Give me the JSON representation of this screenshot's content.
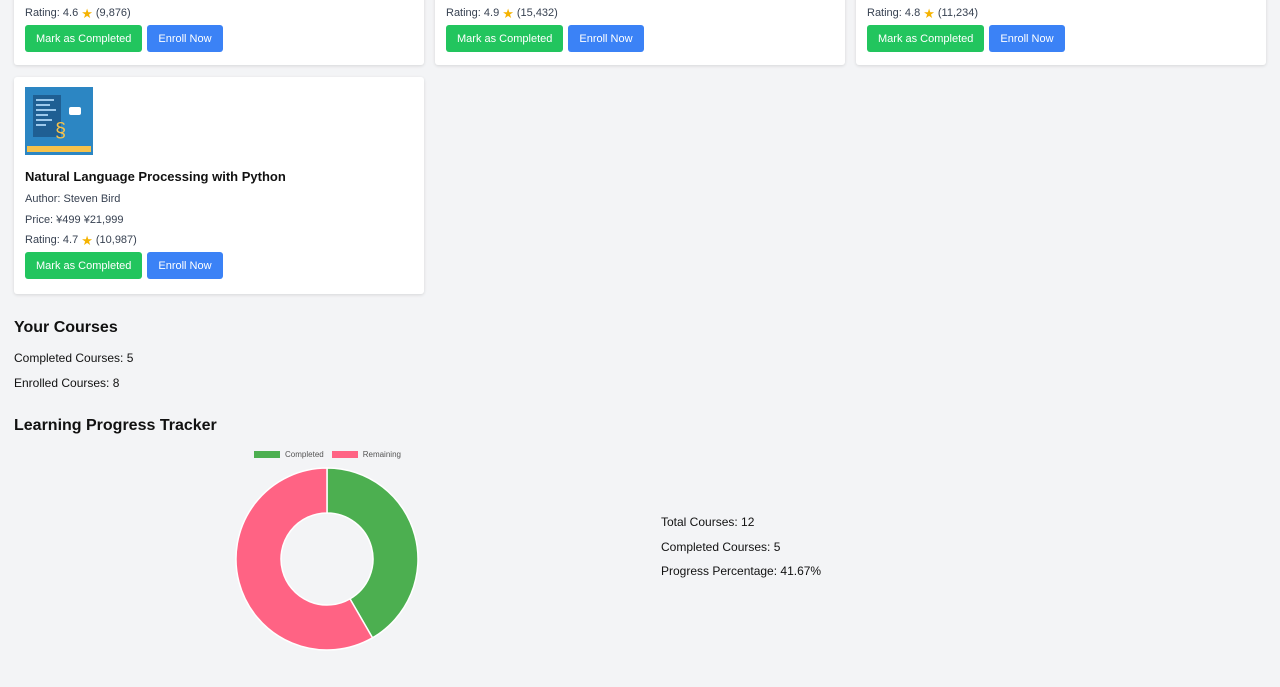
{
  "top_cards": [
    {
      "rating_prefix": "Rating: 4.6",
      "rating_count": "(9,876)",
      "complete_label": "Mark as Completed",
      "enroll_label": "Enroll Now"
    },
    {
      "rating_prefix": "Rating: 4.9",
      "rating_count": "(15,432)",
      "complete_label": "Mark as Completed",
      "enroll_label": "Enroll Now"
    },
    {
      "rating_prefix": "Rating: 4.8",
      "rating_count": "(11,234)",
      "complete_label": "Mark as Completed",
      "enroll_label": "Enroll Now"
    }
  ],
  "nlp_card": {
    "title": "Natural Language Processing with Python",
    "author": "Author: Steven Bird",
    "price": "Price: ¥499 ¥21,999",
    "rating_prefix": "Rating: 4.7",
    "rating_count": "(10,987)",
    "complete_label": "Mark as Completed",
    "enroll_label": "Enroll Now",
    "image_icon": "python-course-thumbnail"
  },
  "your_courses": {
    "title": "Your Courses",
    "completed": "Completed Courses: 5",
    "enrolled": "Enrolled Courses: 8"
  },
  "progress": {
    "title": "Learning Progress Tracker",
    "total": "Total Courses: 12",
    "completed": "Completed Courses: 5",
    "percentage": "Progress Percentage: 41.67%"
  },
  "icons": {
    "star": "star-icon"
  },
  "colors": {
    "completed": "#4caf50",
    "remaining": "#ff6384",
    "green_button": "#22c55e",
    "blue_button": "#3b82f6"
  },
  "chart_data": {
    "type": "pie",
    "categories": [
      "Completed",
      "Remaining"
    ],
    "values": [
      5,
      7
    ],
    "colors": [
      "#4caf50",
      "#ff6384"
    ],
    "legend_position": "top",
    "style": "doughnut"
  }
}
